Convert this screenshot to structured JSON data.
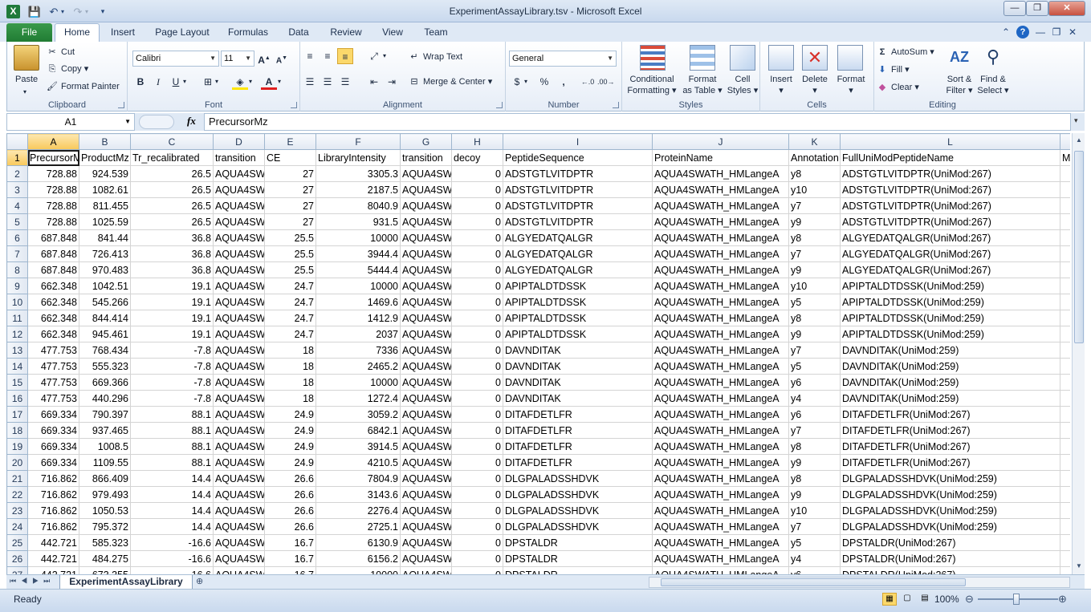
{
  "app": {
    "title": "ExperimentAssayLibrary.tsv  -  Microsoft Excel",
    "icon_letter": "X"
  },
  "window_controls": {
    "minimize": "—",
    "restore": "❐",
    "close": "✕"
  },
  "ribbon_tabs": [
    "File",
    "Home",
    "Insert",
    "Page Layout",
    "Formulas",
    "Data",
    "Review",
    "View",
    "Team"
  ],
  "ribbon": {
    "clipboard": {
      "label": "Clipboard",
      "paste": "Paste",
      "cut": "Cut",
      "copy": "Copy",
      "format_painter": "Format Painter"
    },
    "font": {
      "label": "Font",
      "name": "Calibri",
      "size": "11"
    },
    "alignment": {
      "label": "Alignment",
      "wrap_text": "Wrap Text",
      "merge_center": "Merge & Center"
    },
    "number": {
      "label": "Number",
      "format": "General"
    },
    "styles": {
      "label": "Styles",
      "conditional": "Conditional",
      "formatting": "Formatting",
      "format_as": "Format",
      "as_table": "as Table",
      "cell": "Cell",
      "styles_btn": "Styles"
    },
    "cells": {
      "label": "Cells",
      "insert": "Insert",
      "delete": "Delete",
      "format": "Format"
    },
    "editing": {
      "label": "Editing",
      "autosum": "AutoSum",
      "fill": "Fill",
      "clear": "Clear",
      "sort": "Sort &",
      "filter": "Filter",
      "find": "Find &",
      "select": "Select"
    }
  },
  "formula_bar": {
    "name_box": "A1",
    "fx": "fx",
    "value": "PrecursorMz"
  },
  "columns": [
    {
      "letter": "A",
      "width": 64
    },
    {
      "letter": "B",
      "width": 64
    },
    {
      "letter": "C",
      "width": 103
    },
    {
      "letter": "D",
      "width": 64
    },
    {
      "letter": "E",
      "width": 64
    },
    {
      "letter": "F",
      "width": 105
    },
    {
      "letter": "G",
      "width": 64
    },
    {
      "letter": "H",
      "width": 64
    },
    {
      "letter": "I",
      "width": 186
    },
    {
      "letter": "J",
      "width": 170
    },
    {
      "letter": "K",
      "width": 64
    },
    {
      "letter": "L",
      "width": 274
    },
    {
      "letter": "",
      "width": 40
    }
  ],
  "header_row": [
    "PrecursorMz",
    "ProductMz",
    "Tr_recalibrated",
    "transition",
    "CE",
    "LibraryIntensity",
    "transition",
    "decoy",
    "PeptideSequence",
    "ProteinName",
    "Annotation",
    "FullUniModPeptideName",
    "Mi"
  ],
  "rows": [
    [
      "728.88",
      "924.539",
      "26.5",
      "AQUA4SW",
      "27",
      "3305.3",
      "AQUA4SW",
      "0",
      "ADSTGTLVITDPTR",
      "AQUA4SWATH_HMLangeA",
      "y8",
      "ADSTGTLVITDPTR(UniMod:267)",
      ""
    ],
    [
      "728.88",
      "1082.61",
      "26.5",
      "AQUA4SW",
      "27",
      "2187.5",
      "AQUA4SW",
      "0",
      "ADSTGTLVITDPTR",
      "AQUA4SWATH_HMLangeA",
      "y10",
      "ADSTGTLVITDPTR(UniMod:267)",
      ""
    ],
    [
      "728.88",
      "811.455",
      "26.5",
      "AQUA4SW",
      "27",
      "8040.9",
      "AQUA4SW",
      "0",
      "ADSTGTLVITDPTR",
      "AQUA4SWATH_HMLangeA",
      "y7",
      "ADSTGTLVITDPTR(UniMod:267)",
      ""
    ],
    [
      "728.88",
      "1025.59",
      "26.5",
      "AQUA4SW",
      "27",
      "931.5",
      "AQUA4SW",
      "0",
      "ADSTGTLVITDPTR",
      "AQUA4SWATH_HMLangeA",
      "y9",
      "ADSTGTLVITDPTR(UniMod:267)",
      ""
    ],
    [
      "687.848",
      "841.44",
      "36.8",
      "AQUA4SW",
      "25.5",
      "10000",
      "AQUA4SW",
      "0",
      "ALGYEDATQALGR",
      "AQUA4SWATH_HMLangeA",
      "y8",
      "ALGYEDATQALGR(UniMod:267)",
      ""
    ],
    [
      "687.848",
      "726.413",
      "36.8",
      "AQUA4SW",
      "25.5",
      "3944.4",
      "AQUA4SW",
      "0",
      "ALGYEDATQALGR",
      "AQUA4SWATH_HMLangeA",
      "y7",
      "ALGYEDATQALGR(UniMod:267)",
      ""
    ],
    [
      "687.848",
      "970.483",
      "36.8",
      "AQUA4SW",
      "25.5",
      "5444.4",
      "AQUA4SW",
      "0",
      "ALGYEDATQALGR",
      "AQUA4SWATH_HMLangeA",
      "y9",
      "ALGYEDATQALGR(UniMod:267)",
      ""
    ],
    [
      "662.348",
      "1042.51",
      "19.1",
      "AQUA4SW",
      "24.7",
      "10000",
      "AQUA4SW",
      "0",
      "APIPTALDTDSSK",
      "AQUA4SWATH_HMLangeA",
      "y10",
      "APIPTALDTDSSK(UniMod:259)",
      ""
    ],
    [
      "662.348",
      "545.266",
      "19.1",
      "AQUA4SW",
      "24.7",
      "1469.6",
      "AQUA4SW",
      "0",
      "APIPTALDTDSSK",
      "AQUA4SWATH_HMLangeA",
      "y5",
      "APIPTALDTDSSK(UniMod:259)",
      ""
    ],
    [
      "662.348",
      "844.414",
      "19.1",
      "AQUA4SW",
      "24.7",
      "1412.9",
      "AQUA4SW",
      "0",
      "APIPTALDTDSSK",
      "AQUA4SWATH_HMLangeA",
      "y8",
      "APIPTALDTDSSK(UniMod:259)",
      ""
    ],
    [
      "662.348",
      "945.461",
      "19.1",
      "AQUA4SW",
      "24.7",
      "2037",
      "AQUA4SW",
      "0",
      "APIPTALDTDSSK",
      "AQUA4SWATH_HMLangeA",
      "y9",
      "APIPTALDTDSSK(UniMod:259)",
      ""
    ],
    [
      "477.753",
      "768.434",
      "-7.8",
      "AQUA4SW",
      "18",
      "7336",
      "AQUA4SW",
      "0",
      "DAVNDITAK",
      "AQUA4SWATH_HMLangeA",
      "y7",
      "DAVNDITAK(UniMod:259)",
      ""
    ],
    [
      "477.753",
      "555.323",
      "-7.8",
      "AQUA4SW",
      "18",
      "2465.2",
      "AQUA4SW",
      "0",
      "DAVNDITAK",
      "AQUA4SWATH_HMLangeA",
      "y5",
      "DAVNDITAK(UniMod:259)",
      ""
    ],
    [
      "477.753",
      "669.366",
      "-7.8",
      "AQUA4SW",
      "18",
      "10000",
      "AQUA4SW",
      "0",
      "DAVNDITAK",
      "AQUA4SWATH_HMLangeA",
      "y6",
      "DAVNDITAK(UniMod:259)",
      ""
    ],
    [
      "477.753",
      "440.296",
      "-7.8",
      "AQUA4SW",
      "18",
      "1272.4",
      "AQUA4SW",
      "0",
      "DAVNDITAK",
      "AQUA4SWATH_HMLangeA",
      "y4",
      "DAVNDITAK(UniMod:259)",
      ""
    ],
    [
      "669.334",
      "790.397",
      "88.1",
      "AQUA4SW",
      "24.9",
      "3059.2",
      "AQUA4SW",
      "0",
      "DITAFDETLFR",
      "AQUA4SWATH_HMLangeA",
      "y6",
      "DITAFDETLFR(UniMod:267)",
      ""
    ],
    [
      "669.334",
      "937.465",
      "88.1",
      "AQUA4SW",
      "24.9",
      "6842.1",
      "AQUA4SW",
      "0",
      "DITAFDETLFR",
      "AQUA4SWATH_HMLangeA",
      "y7",
      "DITAFDETLFR(UniMod:267)",
      ""
    ],
    [
      "669.334",
      "1008.5",
      "88.1",
      "AQUA4SW",
      "24.9",
      "3914.5",
      "AQUA4SW",
      "0",
      "DITAFDETLFR",
      "AQUA4SWATH_HMLangeA",
      "y8",
      "DITAFDETLFR(UniMod:267)",
      ""
    ],
    [
      "669.334",
      "1109.55",
      "88.1",
      "AQUA4SW",
      "24.9",
      "4210.5",
      "AQUA4SW",
      "0",
      "DITAFDETLFR",
      "AQUA4SWATH_HMLangeA",
      "y9",
      "DITAFDETLFR(UniMod:267)",
      ""
    ],
    [
      "716.862",
      "866.409",
      "14.4",
      "AQUA4SW",
      "26.6",
      "7804.9",
      "AQUA4SW",
      "0",
      "DLGPALADSSHDVK",
      "AQUA4SWATH_HMLangeA",
      "y8",
      "DLGPALADSSHDVK(UniMod:259)",
      ""
    ],
    [
      "716.862",
      "979.493",
      "14.4",
      "AQUA4SW",
      "26.6",
      "3143.6",
      "AQUA4SW",
      "0",
      "DLGPALADSSHDVK",
      "AQUA4SWATH_HMLangeA",
      "y9",
      "DLGPALADSSHDVK(UniMod:259)",
      ""
    ],
    [
      "716.862",
      "1050.53",
      "14.4",
      "AQUA4SW",
      "26.6",
      "2276.4",
      "AQUA4SW",
      "0",
      "DLGPALADSSHDVK",
      "AQUA4SWATH_HMLangeA",
      "y10",
      "DLGPALADSSHDVK(UniMod:259)",
      ""
    ],
    [
      "716.862",
      "795.372",
      "14.4",
      "AQUA4SW",
      "26.6",
      "2725.1",
      "AQUA4SW",
      "0",
      "DLGPALADSSHDVK",
      "AQUA4SWATH_HMLangeA",
      "y7",
      "DLGPALADSSHDVK(UniMod:259)",
      ""
    ],
    [
      "442.721",
      "585.323",
      "-16.6",
      "AQUA4SW",
      "16.7",
      "6130.9",
      "AQUA4SW",
      "0",
      "DPSTALDR",
      "AQUA4SWATH_HMLangeA",
      "y5",
      "DPSTALDR(UniMod:267)",
      ""
    ],
    [
      "442.721",
      "484.275",
      "-16.6",
      "AQUA4SW",
      "16.7",
      "6156.2",
      "AQUA4SW",
      "0",
      "DPSTALDR",
      "AQUA4SWATH_HMLangeA",
      "y4",
      "DPSTALDR(UniMod:267)",
      ""
    ],
    [
      "442.721",
      "673.355",
      "-16.6",
      "AQUA4SW",
      "16.7",
      "10000",
      "AQUA4SW",
      "0",
      "DPSTALDR",
      "AQUA4SWATH_HMLangeA",
      "y6",
      "DPSTALDR(UniMod:267)",
      ""
    ]
  ],
  "numeric_columns": [
    0,
    1,
    2,
    4,
    5,
    7
  ],
  "sheet_tab": "ExperimentAssayLibrary",
  "status": {
    "ready": "Ready",
    "zoom": "100%"
  }
}
